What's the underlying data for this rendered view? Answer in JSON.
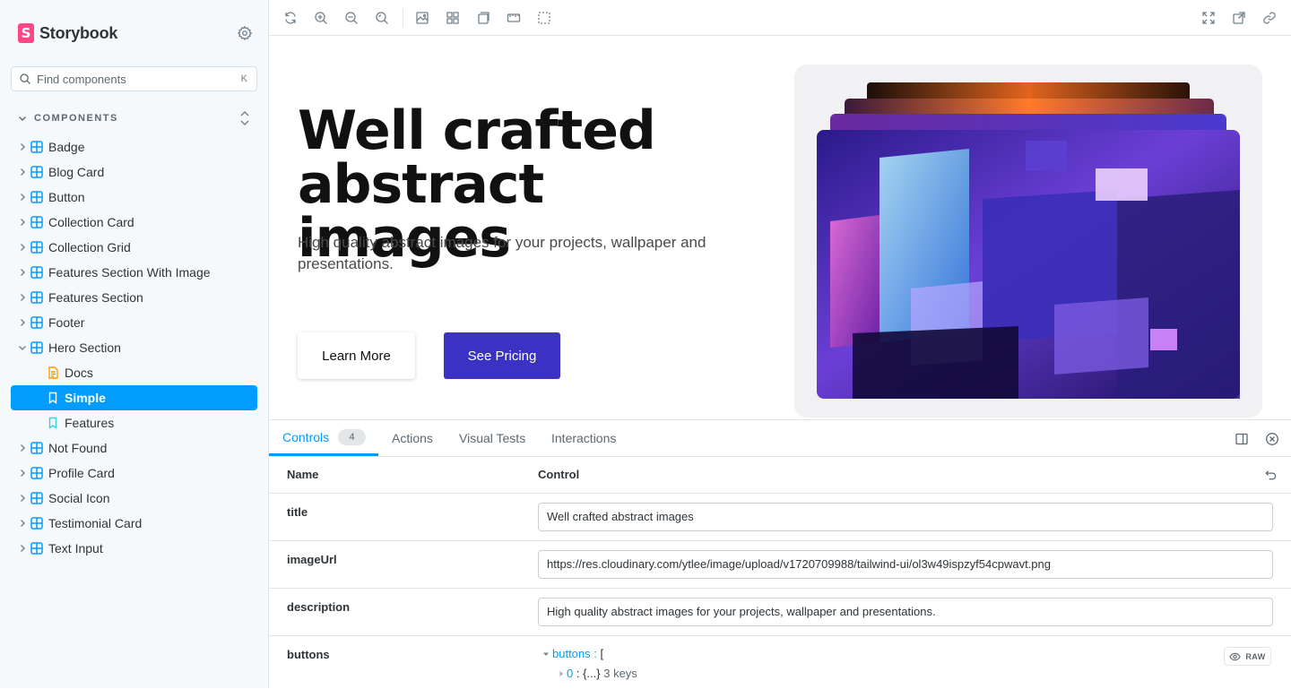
{
  "sidebar": {
    "brand": "Storybook",
    "search_placeholder": "Find components",
    "search_shortcut": "K",
    "section_label": "COMPONENTS",
    "items": [
      {
        "label": "Badge"
      },
      {
        "label": "Blog Card"
      },
      {
        "label": "Button"
      },
      {
        "label": "Collection Card"
      },
      {
        "label": "Collection Grid"
      },
      {
        "label": "Features Section With Image"
      },
      {
        "label": "Features Section"
      },
      {
        "label": "Footer"
      },
      {
        "label": "Hero Section",
        "expanded": true
      },
      {
        "label": "Docs",
        "child": true,
        "kind": "docs"
      },
      {
        "label": "Simple",
        "child": true,
        "kind": "story",
        "selected": true
      },
      {
        "label": "Features",
        "child": true,
        "kind": "story"
      },
      {
        "label": "Not Found"
      },
      {
        "label": "Profile Card"
      },
      {
        "label": "Social Icon"
      },
      {
        "label": "Testimonial Card"
      },
      {
        "label": "Text Input"
      }
    ]
  },
  "preview": {
    "title": "Well crafted abstract images",
    "description": "High quality abstract images for your projects, wallpaper and presentations.",
    "learn_more": "Learn More",
    "see_pricing": "See Pricing"
  },
  "panel": {
    "tabs": {
      "controls": "Controls",
      "controls_count": "4",
      "actions": "Actions",
      "visual_tests": "Visual Tests",
      "interactions": "Interactions"
    },
    "columns": {
      "name": "Name",
      "control": "Control"
    },
    "rows": {
      "title": {
        "name": "title",
        "value": "Well crafted abstract images"
      },
      "imageUrl": {
        "name": "imageUrl",
        "value": "https://res.cloudinary.com/ytlee/image/upload/v1720709988/tailwind-ui/ol3w49ispzyf54cpwavt.png"
      },
      "description": {
        "name": "description",
        "value": "High quality abstract images for your projects, wallpaper and presentations."
      },
      "buttons": {
        "name": "buttons",
        "key": "buttons",
        "open": "[",
        "index0": "0",
        "collapsed": "{...}",
        "summary": "3 keys",
        "raw": "RAW"
      }
    }
  },
  "colors": {
    "accent": "#029cfd",
    "brand": "#ff4785",
    "primary_button": "#3b32c4",
    "sidebar_bg": "#f6f9fc"
  }
}
